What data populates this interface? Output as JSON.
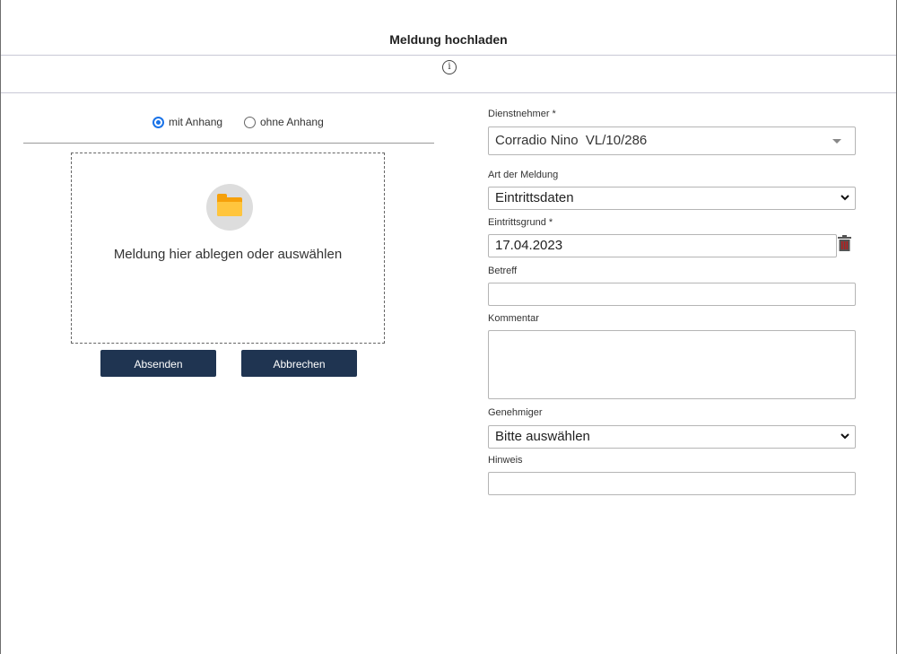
{
  "header": {
    "title": "Meldung hochladen",
    "info_icon": "info-icon"
  },
  "upload": {
    "radio_with": "mit Anhang",
    "radio_without": "ohne Anhang",
    "selected": "mit Anhang",
    "drop_text": "Meldung hier ablegen oder auswählen",
    "folder_icon": "folder-icon",
    "send_label": "Absenden",
    "cancel_label": "Abbrechen"
  },
  "form": {
    "employee": {
      "label": "Dienstnehmer *",
      "value": "Corradio Nino  VL/10/286"
    },
    "type": {
      "label": "Art der Meldung",
      "value": "Eintrittsdaten"
    },
    "reason": {
      "label": "Eintrittsgrund *",
      "value": "17.04.2023",
      "delete_icon": "trash-icon"
    },
    "subject": {
      "label": "Betreff",
      "value": ""
    },
    "comment": {
      "label": "Kommentar",
      "value": ""
    },
    "approver": {
      "label": "Genehmiger",
      "value": "Bitte auswählen"
    },
    "note": {
      "label": "Hinweis",
      "value": ""
    }
  },
  "colors": {
    "primary_button": "#1f3451",
    "radio_accent": "#1a73e8",
    "folder": "#f6a00a",
    "trash": "#b71c1c"
  }
}
